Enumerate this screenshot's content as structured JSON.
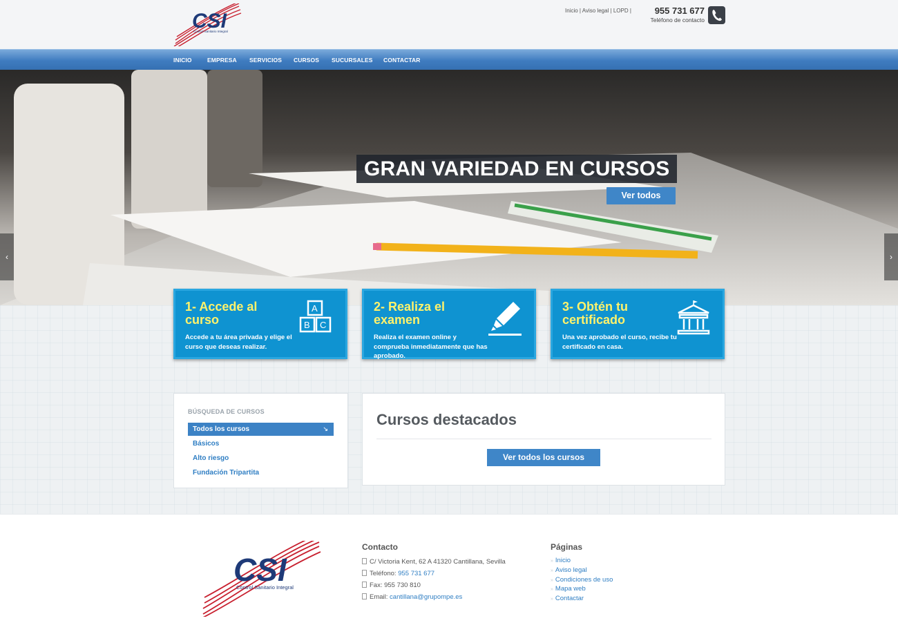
{
  "header": {
    "top_links": [
      "Inicio",
      "Aviso legal",
      "LOPD"
    ],
    "phone_number": "955 731 677",
    "phone_label": "Teléfono de contacto",
    "logo_text": "CSI",
    "logo_subtext": "Control Sanitario Integral"
  },
  "nav": [
    "INICIO",
    "EMPRESA",
    "SERVICIOS",
    "CURSOS",
    "SUCURSALES",
    "CONTACTAR"
  ],
  "hero": {
    "title": "GRAN VARIEDAD EN CURSOS",
    "button": "Ver todos",
    "arrow_left": "‹",
    "arrow_right": "›"
  },
  "steps": [
    {
      "title": "1- Accede al curso",
      "text": "Accede a tu área privada y elige el curso que deseas realizar.",
      "icon": "abc-blocks-icon"
    },
    {
      "title": "2- Realiza el examen",
      "text": "Realiza el examen online y comprueba inmediatamente que has aprobado.",
      "icon": "highlighter-icon"
    },
    {
      "title": "3- Obtén tu certificado",
      "text": "Una vez aprobado el curso, recibe tu certificado en casa.",
      "icon": "institution-icon"
    }
  ],
  "search": {
    "title": "BÚSQUEDA DE CURSOS",
    "items": [
      "Todos los cursos",
      "Básicos",
      "Alto riesgo",
      "Fundación Tripartita"
    ],
    "active_corner": "↘"
  },
  "featured": {
    "title": "Cursos destacados",
    "button": "Ver todos los cursos"
  },
  "footer": {
    "contact_heading": "Contacto",
    "address": "C/ Victoria Kent, 62 A 41320 Cantillana, Sevilla",
    "phone_prefix": "Teléfono: ",
    "phone": "955 731 677",
    "fax": "Fax: 955 730 810",
    "email_prefix": "Email: ",
    "email": "cantillana@grupompe.es",
    "pages_heading": "Páginas",
    "pages": [
      "Inicio",
      "Aviso legal",
      "Condiciones de uso",
      "Mapa web",
      "Contactar"
    ]
  },
  "colors": {
    "nav_blue": "#3f7cc0",
    "step_blue": "#0f93d1",
    "step_title_yellow": "#fff26b",
    "button_blue": "#3f86c8",
    "logo_red": "#c8202f",
    "logo_navy": "#1e3a78"
  }
}
